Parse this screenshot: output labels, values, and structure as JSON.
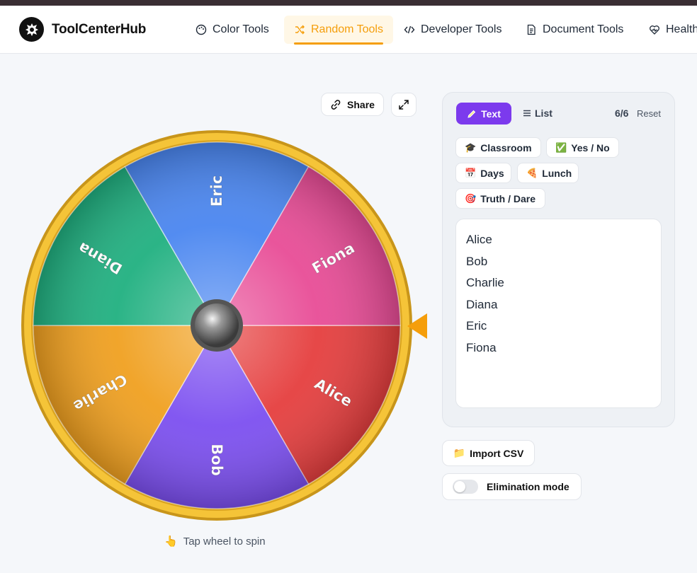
{
  "brand": {
    "name": "ToolCenterHub"
  },
  "nav": [
    {
      "label": "Color Tools",
      "icon": "palette-icon",
      "active": false
    },
    {
      "label": "Random Tools",
      "icon": "shuffle-icon",
      "active": true
    },
    {
      "label": "Developer Tools",
      "icon": "code-icon",
      "active": false
    },
    {
      "label": "Document Tools",
      "icon": "document-icon",
      "active": false
    },
    {
      "label": "Health",
      "icon": "heart-icon",
      "active": false
    }
  ],
  "toolbar": {
    "share_label": "Share"
  },
  "wheel": {
    "segments": [
      {
        "label": "Alice",
        "color": "#e53e3e"
      },
      {
        "label": "Bob",
        "color": "#7c4ff0"
      },
      {
        "label": "Charlie",
        "color": "#f0a020"
      },
      {
        "label": "Diana",
        "color": "#20b080"
      },
      {
        "label": "Eric",
        "color": "#4a86f0"
      },
      {
        "label": "Fiona",
        "color": "#e84c96"
      }
    ],
    "rim_color": "#f5c438",
    "pointer_color": "#f59e0b",
    "hint": "Tap wheel to spin",
    "hint_emoji": "👆"
  },
  "panel": {
    "tab_text": "Text",
    "tab_list": "List",
    "count": "6/6",
    "reset": "Reset",
    "presets": [
      {
        "label": "Classroom",
        "emoji": "🎓"
      },
      {
        "label": "Yes / No",
        "emoji": "✅"
      },
      {
        "label": "Days",
        "emoji": "📅"
      },
      {
        "label": "Lunch",
        "emoji": "🍕"
      },
      {
        "label": "Truth / Dare",
        "emoji": "🎯"
      }
    ],
    "entries": [
      "Alice",
      "Bob",
      "Charlie",
      "Diana",
      "Eric",
      "Fiona"
    ]
  },
  "actions": {
    "import_csv": "Import CSV",
    "import_emoji": "📁",
    "elimination": "Elimination mode",
    "elimination_on": false
  },
  "colors": {
    "accent": "#f59e0b",
    "primary": "#7c3aed"
  }
}
